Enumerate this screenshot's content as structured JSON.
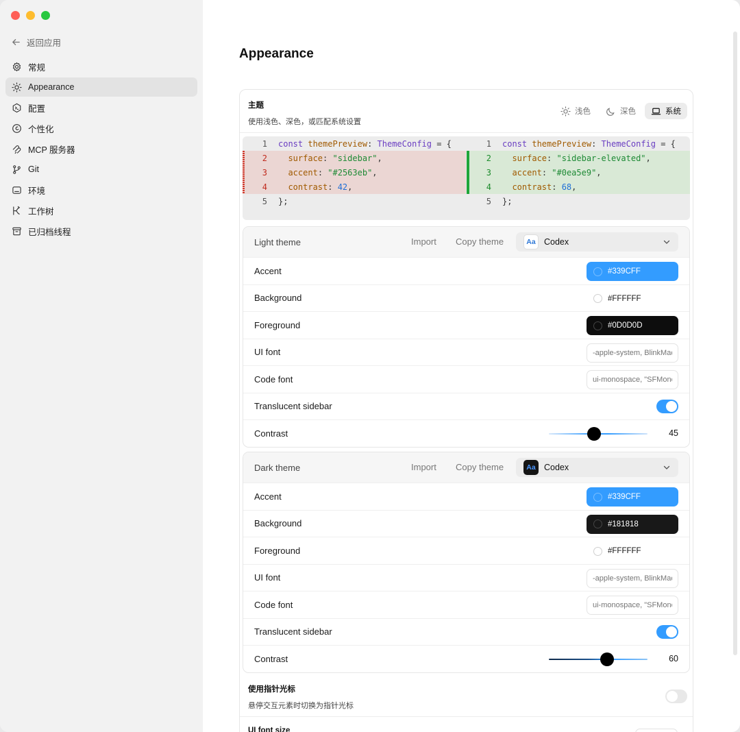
{
  "sidebar": {
    "back_label": "返回应用",
    "items": [
      {
        "label": "常规",
        "icon": "gear-icon"
      },
      {
        "label": "Appearance",
        "icon": "sun-icon",
        "active": true
      },
      {
        "label": "配置",
        "icon": "terminal-icon"
      },
      {
        "label": "个性化",
        "icon": "personalize-icon"
      },
      {
        "label": "MCP 服务器",
        "icon": "mcp-icon"
      },
      {
        "label": "Git",
        "icon": "git-branch-icon"
      },
      {
        "label": "环境",
        "icon": "monitor-icon"
      },
      {
        "label": "工作树",
        "icon": "worktree-icon"
      },
      {
        "label": "已归档线程",
        "icon": "archive-icon"
      }
    ]
  },
  "page": {
    "title": "Appearance"
  },
  "theme": {
    "title": "主题",
    "subtitle": "使用浅色、深色，或匹配系统设置",
    "modes": {
      "light": "浅色",
      "dark": "深色",
      "system": "系统"
    },
    "selected_mode": "system"
  },
  "diff": {
    "left": {
      "l1": "const themePreview: ThemeConfig = {",
      "l2k": "surface",
      "l2v": "\"sidebar\"",
      "l3k": "accent",
      "l3v": "\"#2563eb\"",
      "l4k": "contrast",
      "l4v": "42",
      "l5": "};"
    },
    "right": {
      "l1": "const themePreview: ThemeConfig = {",
      "l2k": "surface",
      "l2v": "\"sidebar-elevated\"",
      "l3k": "accent",
      "l3v": "\"#0ea5e9\"",
      "l4k": "contrast",
      "l4v": "68",
      "l5": "};"
    }
  },
  "light_theme": {
    "name": "Light theme",
    "import_label": "Import",
    "copy_label": "Copy theme",
    "preset_icon_text": "Aa",
    "preset": "Codex",
    "accent_label": "Accent",
    "accent": "#339CFF",
    "background_label": "Background",
    "background": "#FFFFFF",
    "foreground_label": "Foreground",
    "foreground": "#0D0D0D",
    "ui_font_label": "UI font",
    "ui_font": "-apple-system, BlinkMacSystemFont",
    "code_font_label": "Code font",
    "code_font": "ui-monospace, \"SFMono-Regular\"",
    "translucent_label": "Translucent sidebar",
    "translucent": true,
    "contrast_label": "Contrast",
    "contrast": "45"
  },
  "dark_theme": {
    "name": "Dark theme",
    "import_label": "Import",
    "copy_label": "Copy theme",
    "preset_icon_text": "Aa",
    "preset": "Codex",
    "accent_label": "Accent",
    "accent": "#339CFF",
    "background_label": "Background",
    "background": "#181818",
    "foreground_label": "Foreground",
    "foreground": "#FFFFFF",
    "ui_font_label": "UI font",
    "ui_font": "-apple-system, BlinkMacSystemFont",
    "code_font_label": "Code font",
    "code_font": "ui-monospace, \"SFMono-Regular\"",
    "translucent_label": "Translucent sidebar",
    "translucent": true,
    "contrast_label": "Contrast",
    "contrast": "60"
  },
  "pointer": {
    "title": "使用指针光标",
    "subtitle": "悬停交互元素时切换为指针光标",
    "enabled": false
  },
  "ui_font_size": {
    "title": "UI font size"
  }
}
